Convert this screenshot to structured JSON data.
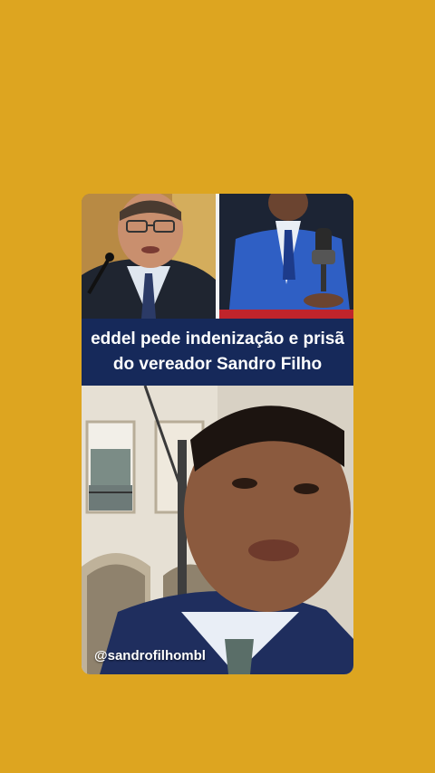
{
  "background_color": "#DDA520",
  "headline": {
    "line1": "eddel pede indenização e prisã",
    "line2": "do vereador Sandro Filho",
    "background": "#16295a"
  },
  "overlay": {
    "handle": "@sandrofilhombl"
  },
  "images": {
    "left": "man-in-suit-speaking-at-microphone",
    "right": "young-man-in-blue-suit-at-podcast-microphone",
    "bottom": "young-man-selfie-in-front-of-colonial-building"
  }
}
